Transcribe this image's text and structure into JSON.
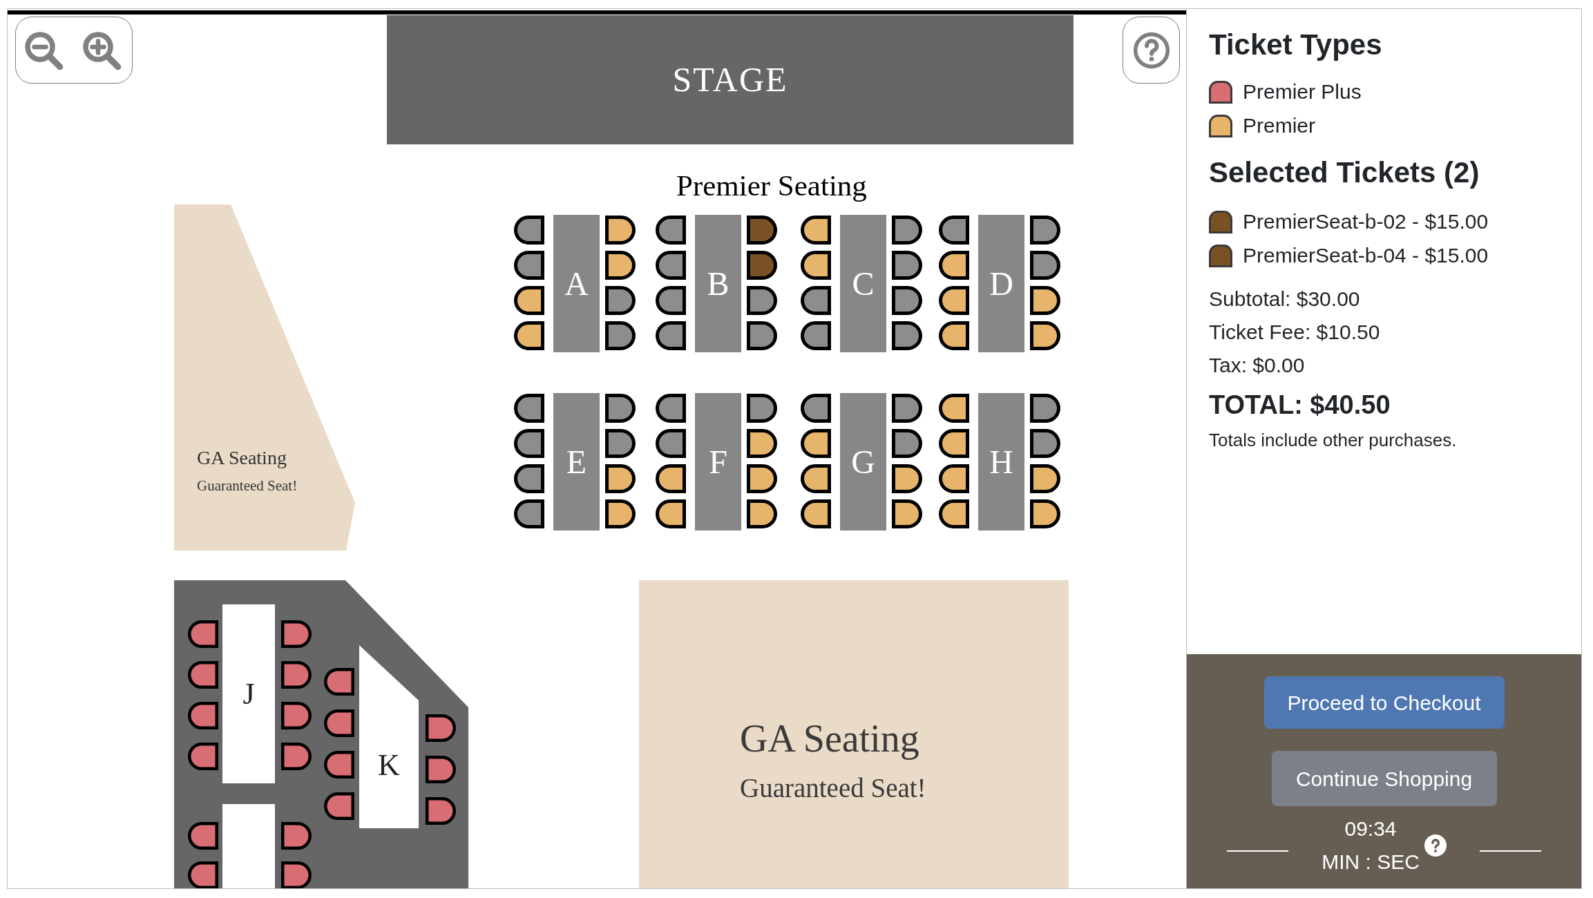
{
  "stage": {
    "label": "STAGE"
  },
  "premier_seating": {
    "title": "Premier Seating",
    "tables": [
      {
        "label": "A",
        "left_seats": [
          {
            "available": false,
            "selected": false
          },
          {
            "available": false,
            "selected": false
          },
          {
            "available": true,
            "selected": false
          },
          {
            "available": true,
            "selected": false
          }
        ],
        "right_seats": [
          {
            "available": true,
            "selected": false
          },
          {
            "available": true,
            "selected": false
          },
          {
            "available": false,
            "selected": false
          },
          {
            "available": false,
            "selected": false
          }
        ]
      },
      {
        "label": "B",
        "left_seats": [
          {
            "available": false,
            "selected": false
          },
          {
            "available": false,
            "selected": false
          },
          {
            "available": false,
            "selected": false
          },
          {
            "available": false,
            "selected": false
          }
        ],
        "right_seats": [
          {
            "available": true,
            "selected": true
          },
          {
            "available": true,
            "selected": true
          },
          {
            "available": false,
            "selected": false
          },
          {
            "available": false,
            "selected": false
          }
        ]
      },
      {
        "label": "C",
        "left_seats": [
          {
            "available": true,
            "selected": false
          },
          {
            "available": true,
            "selected": false
          },
          {
            "available": false,
            "selected": false
          },
          {
            "available": false,
            "selected": false
          }
        ],
        "right_seats": [
          {
            "available": false,
            "selected": false
          },
          {
            "available": false,
            "selected": false
          },
          {
            "available": false,
            "selected": false
          },
          {
            "available": false,
            "selected": false
          }
        ]
      },
      {
        "label": "D",
        "left_seats": [
          {
            "available": false,
            "selected": false
          },
          {
            "available": true,
            "selected": false
          },
          {
            "available": true,
            "selected": false
          },
          {
            "available": true,
            "selected": false
          }
        ],
        "right_seats": [
          {
            "available": false,
            "selected": false
          },
          {
            "available": false,
            "selected": false
          },
          {
            "available": true,
            "selected": false
          },
          {
            "available": true,
            "selected": false
          }
        ]
      },
      {
        "label": "E",
        "left_seats": [
          {
            "available": false,
            "selected": false
          },
          {
            "available": false,
            "selected": false
          },
          {
            "available": false,
            "selected": false
          },
          {
            "available": false,
            "selected": false
          }
        ],
        "right_seats": [
          {
            "available": false,
            "selected": false
          },
          {
            "available": false,
            "selected": false
          },
          {
            "available": true,
            "selected": false
          },
          {
            "available": true,
            "selected": false
          }
        ]
      },
      {
        "label": "F",
        "left_seats": [
          {
            "available": false,
            "selected": false
          },
          {
            "available": false,
            "selected": false
          },
          {
            "available": true,
            "selected": false
          },
          {
            "available": true,
            "selected": false
          }
        ],
        "right_seats": [
          {
            "available": false,
            "selected": false
          },
          {
            "available": true,
            "selected": false
          },
          {
            "available": true,
            "selected": false
          },
          {
            "available": true,
            "selected": false
          }
        ]
      },
      {
        "label": "G",
        "left_seats": [
          {
            "available": false,
            "selected": false
          },
          {
            "available": true,
            "selected": false
          },
          {
            "available": true,
            "selected": false
          },
          {
            "available": true,
            "selected": false
          }
        ],
        "right_seats": [
          {
            "available": false,
            "selected": false
          },
          {
            "available": false,
            "selected": false
          },
          {
            "available": true,
            "selected": false
          },
          {
            "available": true,
            "selected": false
          }
        ]
      },
      {
        "label": "H",
        "left_seats": [
          {
            "available": true,
            "selected": false
          },
          {
            "available": true,
            "selected": false
          },
          {
            "available": true,
            "selected": false
          },
          {
            "available": true,
            "selected": false
          }
        ],
        "right_seats": [
          {
            "available": false,
            "selected": false
          },
          {
            "available": false,
            "selected": false
          },
          {
            "available": true,
            "selected": false
          },
          {
            "available": true,
            "selected": false
          }
        ]
      }
    ]
  },
  "ga_side": {
    "title": "GA Seating",
    "subtitle": "Guaranteed Seat!"
  },
  "premier_plus_seating": {
    "tables": [
      {
        "label": "J",
        "left_seats": [
          {
            "available": true,
            "selected": false
          },
          {
            "available": true,
            "selected": false
          },
          {
            "available": true,
            "selected": false
          },
          {
            "available": true,
            "selected": false
          }
        ],
        "right_seats": [
          {
            "available": true,
            "selected": false
          },
          {
            "available": true,
            "selected": false
          },
          {
            "available": true,
            "selected": false
          },
          {
            "available": true,
            "selected": false
          }
        ]
      },
      {
        "left_seats": [
          {
            "available": true,
            "selected": false
          },
          {
            "available": true,
            "selected": false
          }
        ],
        "right_seats": [
          {
            "available": true,
            "selected": false
          },
          {
            "available": true,
            "selected": false
          }
        ]
      },
      {
        "label": "K",
        "left_seats": [
          {
            "available": true,
            "selected": false
          },
          {
            "available": true,
            "selected": false
          },
          {
            "available": true,
            "selected": false
          },
          {
            "available": true,
            "selected": false
          }
        ],
        "right_seats": [
          {
            "available": true,
            "selected": false
          },
          {
            "available": true,
            "selected": false
          },
          {
            "available": true,
            "selected": false
          }
        ]
      }
    ]
  },
  "ga_main": {
    "title": "GA Seating",
    "subtitle": "Guaranteed Seat!"
  },
  "ticket_types": {
    "title": "Ticket Types",
    "items": [
      {
        "label": "Premier Plus",
        "color": "#d86d73"
      },
      {
        "label": "Premier",
        "color": "#e6b46a"
      }
    ]
  },
  "selected_tickets": {
    "title": "Selected Tickets (2)",
    "items": [
      {
        "label": "PremierSeat-b-02 - $15.00"
      },
      {
        "label": "PremierSeat-b-04 - $15.00"
      }
    ]
  },
  "totals": {
    "subtotal": "Subtotal: $30.00",
    "ticket_fee": "Ticket Fee: $10.50",
    "tax": "Tax: $0.00",
    "total": "TOTAL: $40.50",
    "note": "Totals include other purchases."
  },
  "actions": [
    {
      "label": "Proceed to Checkout",
      "kind": "primary"
    },
    {
      "label": "Continue Shopping",
      "kind": "secondary"
    }
  ],
  "timer": {
    "time": "09:34",
    "units": "MIN : SEC"
  }
}
